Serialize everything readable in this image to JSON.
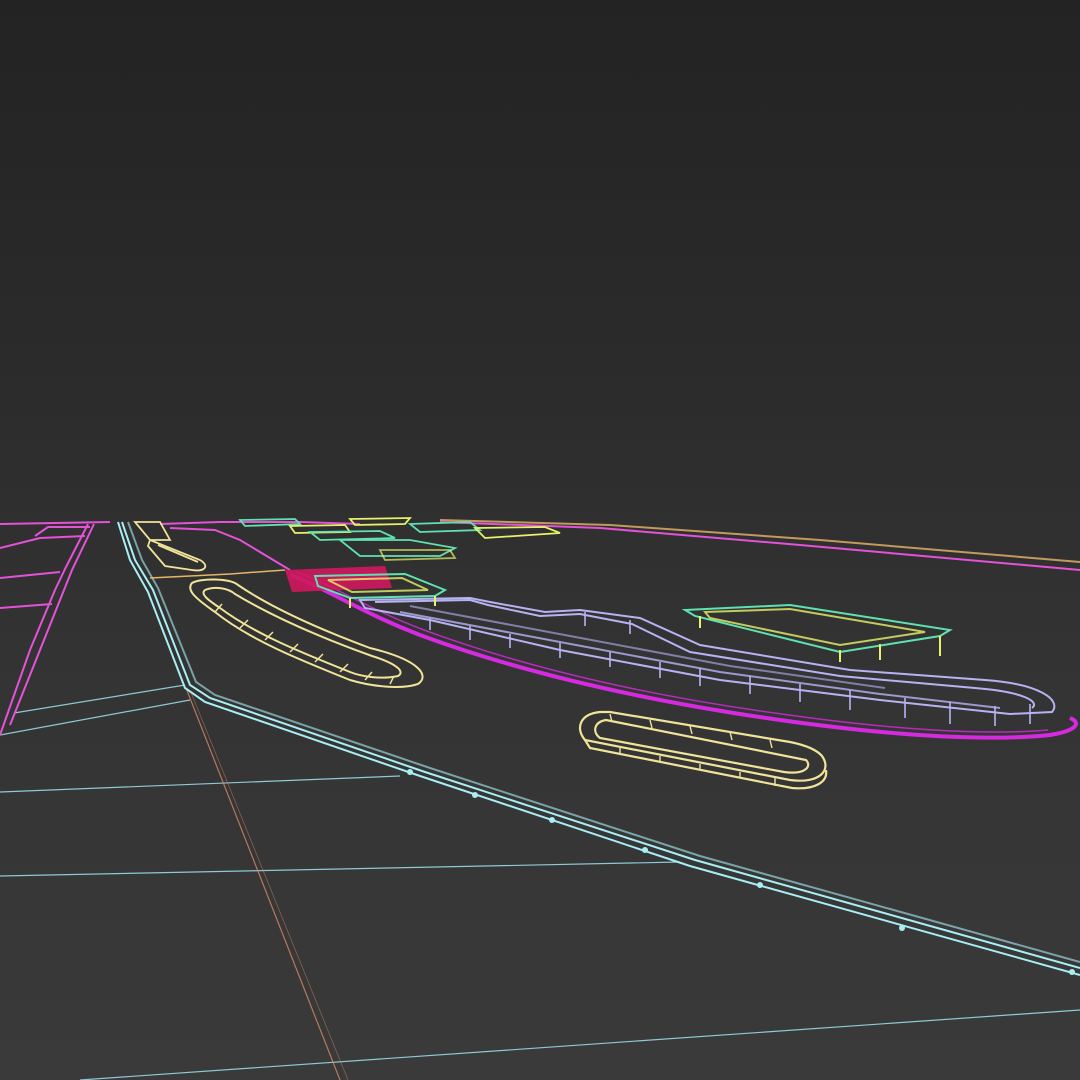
{
  "viewport": {
    "view": "perspective",
    "render_mode": "wireframe",
    "background_top": "#232323",
    "background_bottom": "#3a3a3a"
  },
  "colors": {
    "grid_cyan": "#9fe3ee",
    "road_cyan": "#a9eef5",
    "pink": "#e452d8",
    "magenta": "#d52adf",
    "lavender": "#b7b3f3",
    "yellow": "#f0e39a",
    "green": "#5fe2b0",
    "lime": "#e7f26a",
    "orange_line": "#d98a64",
    "red_fill": "#d2185f"
  }
}
